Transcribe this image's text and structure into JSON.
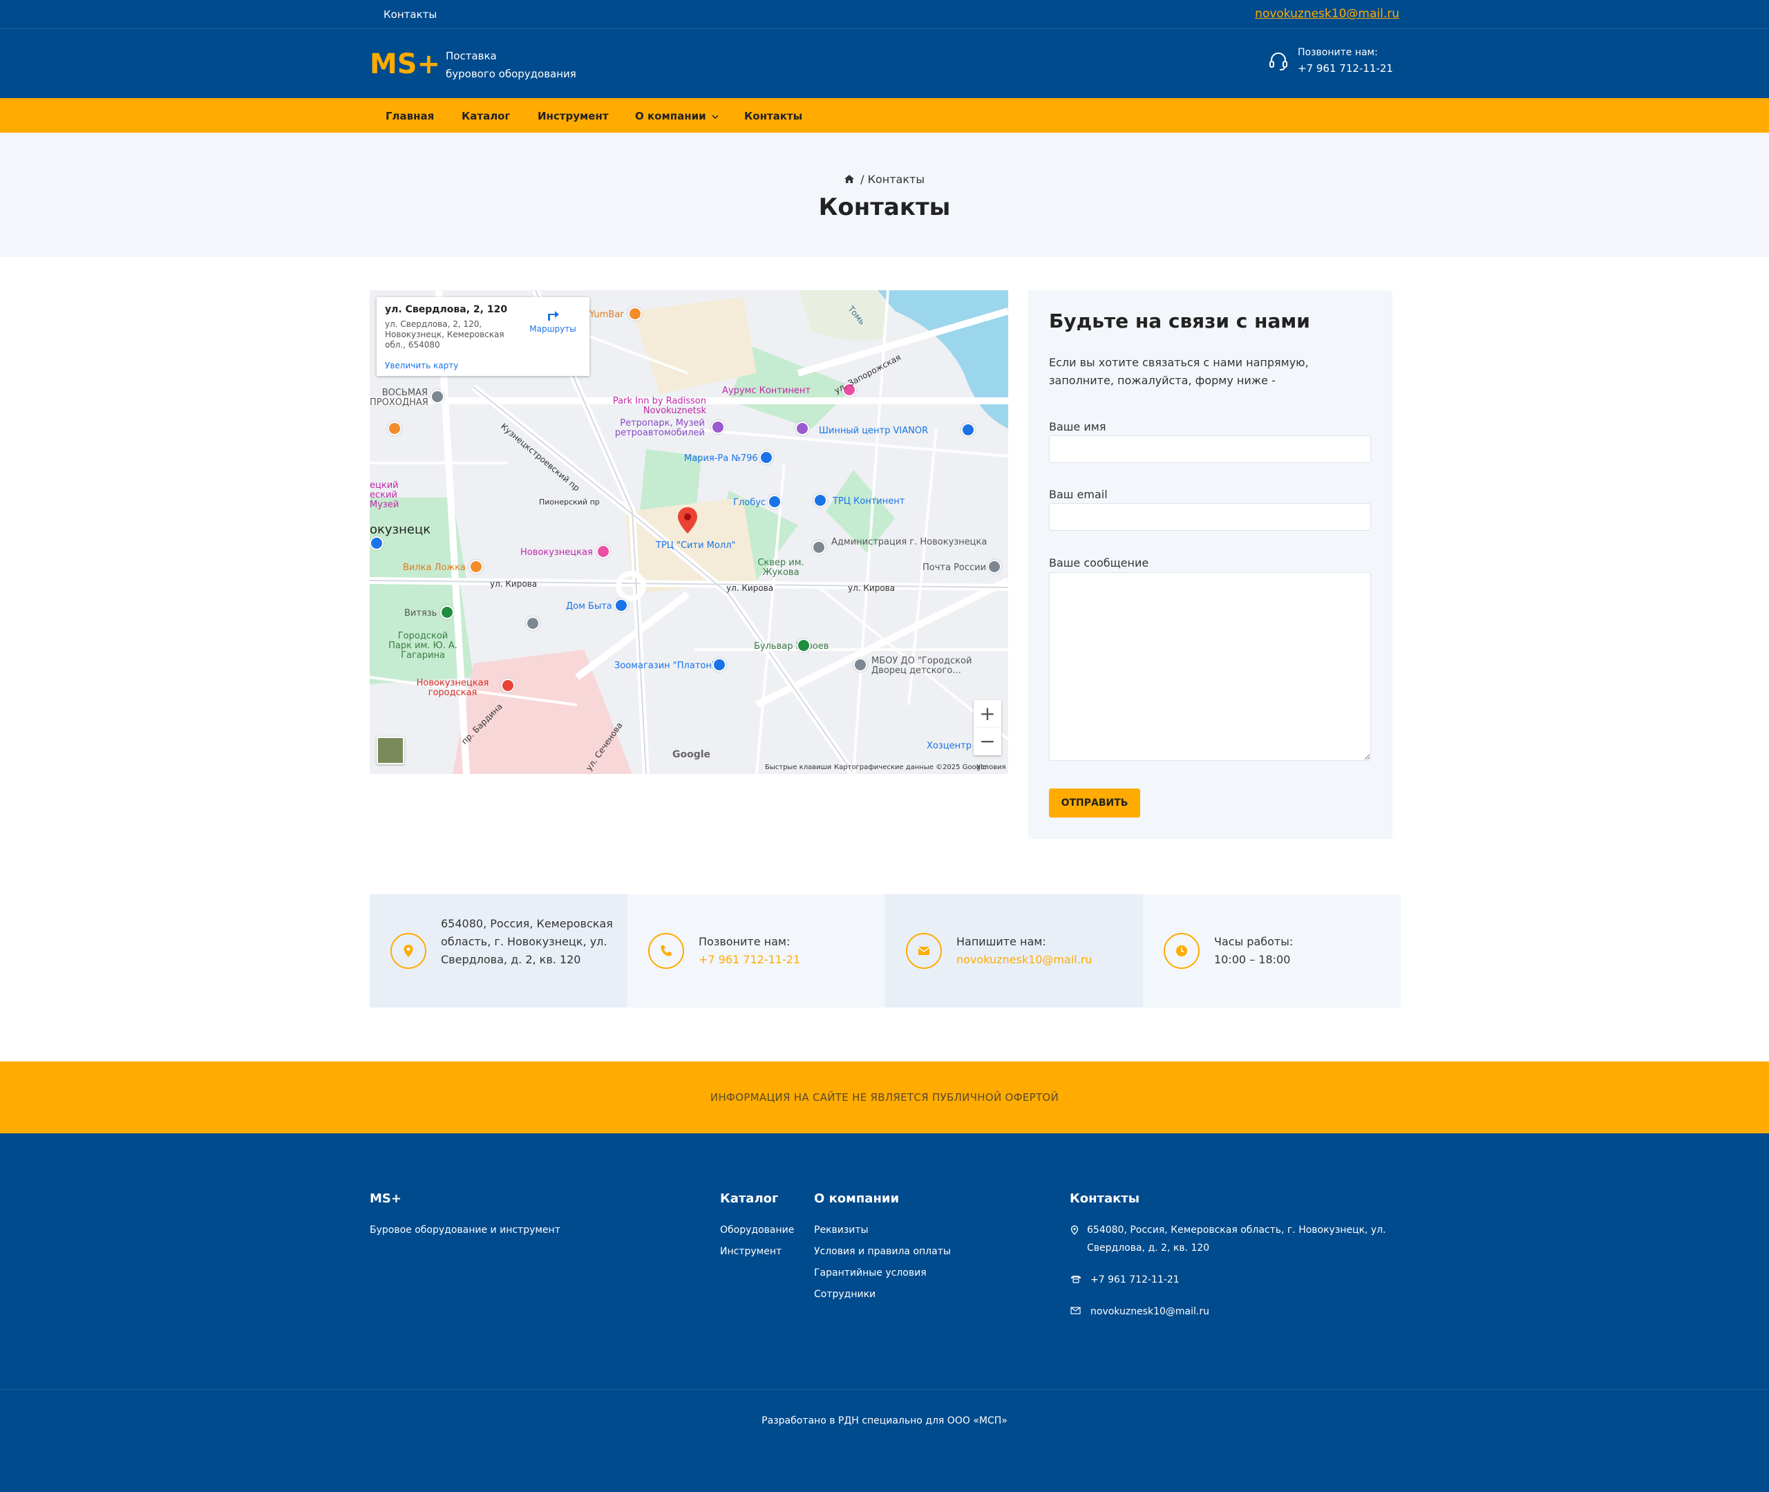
{
  "topbar": {
    "left_link": "Контакты",
    "email": "novokuznesk10@mail.ru"
  },
  "header": {
    "logo": "MS+",
    "tagline_line1": "Поставка",
    "tagline_line2": "бурового оборудования",
    "call_label": "Позвоните нам:",
    "phone": "+7 961 712-11-21"
  },
  "nav": {
    "items": [
      "Главная",
      "Каталог",
      "Инструмент",
      "О компании",
      "Контакты"
    ]
  },
  "breadcrumb": {
    "current": "Контакты",
    "separator": "/"
  },
  "page_title": "Контакты",
  "map": {
    "infobox": {
      "title": "ул. Свердлова, 2, 120",
      "address": "ул. Свердлова, 2, 120, Новокузнецк, Кемеровская обл., 654080",
      "enlarge": "Увеличить карту",
      "routes": "Маршруты"
    },
    "labels": {
      "yumbar": "YumBar",
      "aurums": "Аурумс Континент",
      "parkinn": "Park Inn by Radisson Novokuznetsk",
      "retro": "Ретропарк, Музей ретроавтомобилей",
      "maria": "Мария-Ра №796",
      "vianor": "Шинный центр VIANOR",
      "globus": "Глобус",
      "trc_cont": "ТРЦ Континент",
      "city": "окузнецк",
      "vilka": "Вилка Ложка",
      "novokuz": "Новокузнецкая",
      "citymall": "ТРЦ \"Сити Молл\"",
      "admin": "Администрация г. Новокузнецка",
      "skver": "Сквер им. Жукова",
      "pochta": "Почта России",
      "kirova1": "ул. Кирова",
      "kirova2": "ул. Кирова",
      "kirova3": "ул. Кирова",
      "dombyta": "Дом Быта",
      "vityaz": "Витязь",
      "park": "Городской Парк им. Ю. А. Гагарина",
      "bulvar": "Бульвар Героев",
      "zoomag": "Зоомагазин \"Платон\"",
      "mbou": "МБОУ ДО \"Городской Дворец детского...",
      "hospital": "Новокузнецкая городская",
      "hozcenter": "Хозцентр",
      "pioneer": "Пионерский пр",
      "proh": "ВОСЬМАЯ ПРОХОДНАЯ",
      "kuzn": "Кузнецкстроевский пр",
      "tom": "Томь",
      "zaporoj": "ул. Запорожская",
      "museum": "ецкий еский Музей",
      "bardina": "пр. Бардина",
      "sechenova": "ул. Сеченова",
      "google": "Google"
    },
    "footer": {
      "keys": "Быстрые клавиши",
      "data": "Картографические данные ©2025 Google",
      "terms": "Условия"
    },
    "zoom_in": "+",
    "zoom_out": "−"
  },
  "form": {
    "title": "Будьте на связи с нами",
    "intro": "Если вы хотите связаться с нами напрямую, заполните, пожалуйста, форму ниже -",
    "name_label": "Ваше имя",
    "email_label": "Ваш email",
    "message_label": "Ваше сообщение",
    "name_value": "",
    "email_value": "",
    "message_value": "",
    "submit": "ОТПРАВИТЬ"
  },
  "info": {
    "address": "654080, Россия, Кемеровская область, г. Новокузнецк, ул. Свердлова, д. 2, кв. 120",
    "call_label": "Позвоните нам:",
    "phone": "+7 961 712-11-21",
    "write_label": "Напишите нам:",
    "email": "novokuznesk10@mail.ru",
    "hours_label": "Часы работы:",
    "hours": "10:00 – 18:00"
  },
  "offer": "ИНФОРМАЦИЯ НА САЙТЕ НЕ ЯВЛЯЕТСЯ ПУБЛИЧНОЙ ОФЕРТОЙ",
  "footer": {
    "brand": "MS+",
    "brand_desc": "Буровое оборудование и инструмент",
    "catalog_title": "Каталог",
    "catalog_items": [
      "Оборудование",
      "Инструмент"
    ],
    "about_title": "О компании",
    "about_items": [
      "Реквизиты",
      "Условия и правила оплаты",
      "Гарантийные условия",
      "Сотрудники"
    ],
    "contacts_title": "Контакты",
    "address_line1": "654080, Россия, Кемеровская область, г. Новокузнецк, ул.",
    "address_line2": "Свердлова, д. 2, кв. 120",
    "phone": "+7 961 712-11-21",
    "email": "novokuznesk10@mail.ru",
    "copyright": "Разработано в РДН специально для ООО «МСП»"
  },
  "colors": {
    "primary": "#004b8d",
    "accent": "#ffab00",
    "light_bg": "#f3f6fa"
  }
}
